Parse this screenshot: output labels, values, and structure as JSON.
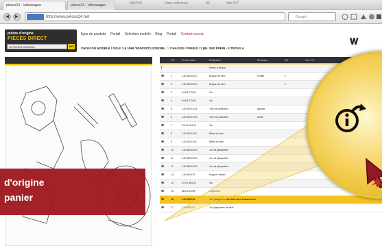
{
  "browser": {
    "tabs": [
      {
        "label": "pièces24 - Volkswagen"
      },
      {
        "label": "pièces24 - Volkswagen"
      }
    ],
    "ghost_tabs": [
      "MATOS",
      "Votre référence",
      "RF",
      "Info 577"
    ],
    "url": "http://www.pièces24.net",
    "search_placeholder": "Google",
    "nav_back": "◀",
    "nav_forward": "▶"
  },
  "site": {
    "logo_top": "pièces d'origine",
    "logo_main": "PIECES DIRECT",
    "logo_input_value": "WVWZZZ1JZ3W386...",
    "logo_go": "GO",
    "menu": [
      {
        "label": "ligne de produits"
      },
      {
        "label": "Portail"
      },
      {
        "label": "Sélection modèle"
      },
      {
        "label": "Blog"
      },
      {
        "label": "Portail"
      },
      {
        "label": "Contact avocat",
        "accent": true
      }
    ],
    "basket_icon": "basket-icon",
    "breadcrumb": "CHOIX DU MODÈLE / GOLF 1.6 1999 'WVWZZZ1JZ2W386...' / CHASSIS / FREINS / 1 (BL 1ER FREIN - 4 TROUS A"
  },
  "table": {
    "columns": [
      "",
      "Pos",
      "Numéro pièce",
      "Désignation",
      "Remarque",
      "Qté",
      "Info / Prix"
    ],
    "rows": [
      {
        "icon": "i",
        "pos": "",
        "part": "",
        "desc": "Freins à disque",
        "note": "",
        "qty": "",
        "info": "",
        "style": "alt"
      },
      {
        "icon": "⊕",
        "pos": "1",
        "part": "1J0 615 301 E",
        "desc": "Disque de frein",
        "note": "ventilé",
        "qty": "2",
        "info": "",
        "style": ""
      },
      {
        "icon": "⊕",
        "pos": "2",
        "part": "1J0 615 301 E",
        "desc": "Disque de frein",
        "note": "",
        "qty": "2",
        "info": "",
        "style": "alt"
      },
      {
        "icon": "⊕",
        "pos": "3",
        "part": "N 902 275 01",
        "desc": "Vis",
        "note": "",
        "qty": "",
        "info": "",
        "style": ""
      },
      {
        "icon": "⊕",
        "pos": "4",
        "part": "N 902 275 01",
        "desc": "Vis",
        "note": "",
        "qty": "",
        "info": "",
        "style": "alt"
      },
      {
        "icon": "⊕",
        "pos": "5",
        "part": "1J0 615 311 B",
        "desc": "Tôle de protection",
        "note": "gauche",
        "qty": "",
        "info": "",
        "style": ""
      },
      {
        "icon": "⊕",
        "pos": "6",
        "part": "1J0 615 312 B",
        "desc": "Tôle de protection",
        "note": "droite",
        "qty": "",
        "info": "",
        "style": "alt"
      },
      {
        "icon": "⊕",
        "pos": "7",
        "part": "N 101 264 01",
        "desc": "Vis",
        "note": "",
        "qty": "",
        "info": "",
        "style": ""
      },
      {
        "icon": "⊕",
        "pos": "8",
        "part": "1J0 615 123 C",
        "desc": "Étrier de frein",
        "note": "",
        "qty": "",
        "info": "",
        "style": "alt"
      },
      {
        "icon": "⊕",
        "pos": "9",
        "part": "1J0 615 124 C",
        "desc": "Étrier de frein",
        "note": "",
        "qty": "",
        "info": "",
        "style": ""
      },
      {
        "icon": "⊕",
        "pos": "10",
        "part": "1J0 698 151 B",
        "desc": "Jeu de plaquettes",
        "note": "",
        "qty": "",
        "info": "",
        "style": "alt"
      },
      {
        "icon": "⊕",
        "pos": "11",
        "part": "1J0 698 151 B",
        "desc": "Jeu de plaquettes",
        "note": "",
        "qty": "",
        "info": "",
        "style": ""
      },
      {
        "icon": "⊕",
        "pos": "12",
        "part": "1J0 698 151 B",
        "desc": "Jeu de plaquettes",
        "note": "",
        "qty": "",
        "info": "",
        "style": "alt"
      },
      {
        "icon": "⊕",
        "pos": "13",
        "part": "1J0 615 423",
        "desc": "Support d'étrier",
        "note": "",
        "qty": "",
        "info": "",
        "style": ""
      },
      {
        "icon": "⊕",
        "pos": "14",
        "part": "N 101 385 01",
        "desc": "Vis",
        "note": "",
        "qty": "",
        "info": "",
        "style": "alt"
      },
      {
        "icon": "⊕",
        "pos": "15",
        "part": "8E0 615 269",
        "desc": "Capuchon",
        "note": "",
        "qty": "",
        "info": "",
        "style": ""
      },
      {
        "icon": "⊕",
        "pos": "16",
        "part": "1J0 698 151",
        "desc": "Jeu plaquettes de frein avec témoin d'usure",
        "note": "",
        "qty": "",
        "info": "",
        "style": "sel"
      },
      {
        "icon": "⊕",
        "pos": "17",
        "part": "1J0 698 151",
        "desc": "Jeu plaquettes de frein",
        "note": "",
        "qty": "",
        "info": "",
        "style": ""
      }
    ]
  },
  "banner": {
    "line1": "d'origine",
    "line2": "panier"
  },
  "zoom": {
    "icon": "info-arrow-icon",
    "cursor": "mouse-cursor-icon"
  },
  "colors": {
    "accent_yellow": "#f2c400",
    "banner_red": "#9e161e",
    "header_dark": "#303030"
  }
}
